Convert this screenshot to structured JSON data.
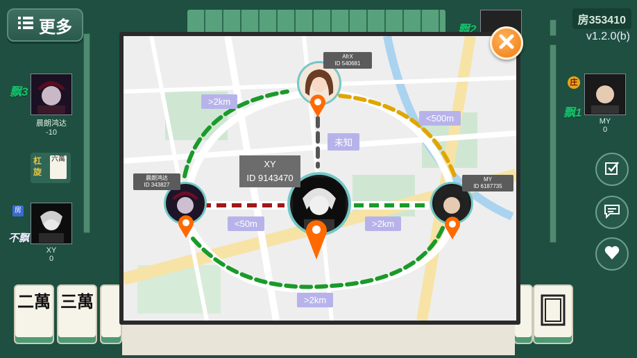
{
  "header": {
    "more_label": "更多",
    "room": "房353410",
    "version": "v1.2.0(b)"
  },
  "seats": {
    "left_top": {
      "piao": "飘3",
      "name": "晨朗鸿达",
      "score": "-10"
    },
    "left_bottom": {
      "tag": "房",
      "piao": "不飘",
      "name": "XY",
      "score": "0"
    },
    "right": {
      "dealer": "庄",
      "piao": "飘1",
      "name": "MY",
      "score": "0"
    },
    "top": {
      "piao": "飘2"
    }
  },
  "side_tile": {
    "label1": "杠",
    "label2": "旋",
    "tile": "六萬"
  },
  "hand_tiles": [
    "二萬",
    "三萬"
  ],
  "location_map": {
    "center_player": {
      "name": "XY",
      "id": "ID 9143470"
    },
    "top_player": {
      "name": "AfrX",
      "id": "ID 540681"
    },
    "left_player": {
      "name": "晨朗鸿达",
      "id": "ID 343827"
    },
    "right_player": {
      "name": "MY",
      "id": "ID 6187735"
    },
    "distances": {
      "top_left": ">2km",
      "top_right": "<500m",
      "top_center": "未知",
      "left_center": "<50m",
      "center_right": ">2km",
      "bottom": ">2km"
    },
    "colors": {
      "far": "#1a9a2a",
      "medium": "#e0a600",
      "near": "#a01818",
      "unknown": "#555555",
      "pin": "#ff6a00"
    }
  }
}
